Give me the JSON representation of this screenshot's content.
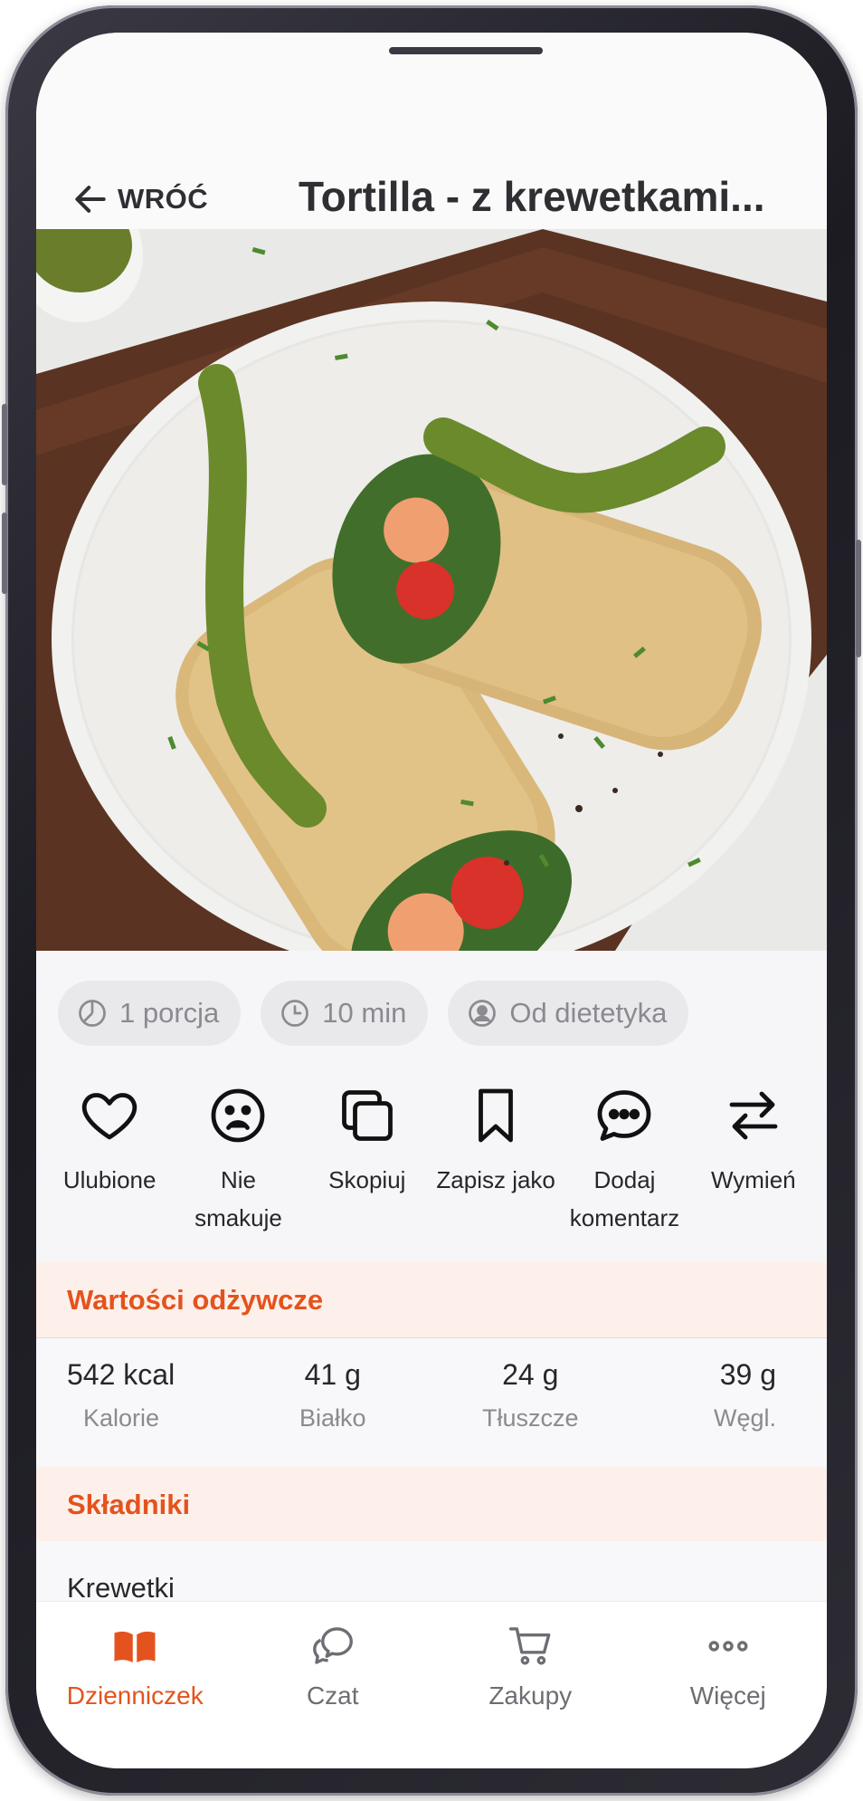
{
  "header": {
    "back_label": "WRÓĆ",
    "title": "Tortilla - z krewetkami..."
  },
  "chips": [
    {
      "icon": "portion-icon",
      "label": "1 porcja"
    },
    {
      "icon": "clock-icon",
      "label": "10 min"
    },
    {
      "icon": "dietitian-icon",
      "label": "Od dietetyka"
    }
  ],
  "actions": [
    {
      "icon": "heart-icon",
      "label": "Ulubione"
    },
    {
      "icon": "sad-face-icon",
      "label": "Nie smakuje"
    },
    {
      "icon": "copy-icon",
      "label": "Skopiuj"
    },
    {
      "icon": "bookmark-icon",
      "label": "Zapisz jako"
    },
    {
      "icon": "comment-icon",
      "label": "Dodaj komentarz"
    },
    {
      "icon": "swap-icon",
      "label": "Wymień"
    }
  ],
  "nutrition": {
    "title": "Wartości odżywcze",
    "items": [
      {
        "value": "542 kcal",
        "label": "Kalorie"
      },
      {
        "value": "41 g",
        "label": "Białko"
      },
      {
        "value": "24 g",
        "label": "Tłuszcze"
      },
      {
        "value": "39 g",
        "label": "Węgl."
      }
    ]
  },
  "ingredients": {
    "title": "Składniki",
    "items": [
      "Krewetki"
    ]
  },
  "bottom_nav": [
    {
      "icon": "book-icon",
      "label": "Dzienniczek",
      "active": true
    },
    {
      "icon": "chat-icon",
      "label": "Czat",
      "active": false
    },
    {
      "icon": "cart-icon",
      "label": "Zakupy",
      "active": false
    },
    {
      "icon": "more-icon",
      "label": "Więcej",
      "active": false
    }
  ],
  "colors": {
    "accent": "#e4531d",
    "section_bg": "#fdf0ea",
    "text": "#26262b",
    "muted": "#8a8a90"
  }
}
